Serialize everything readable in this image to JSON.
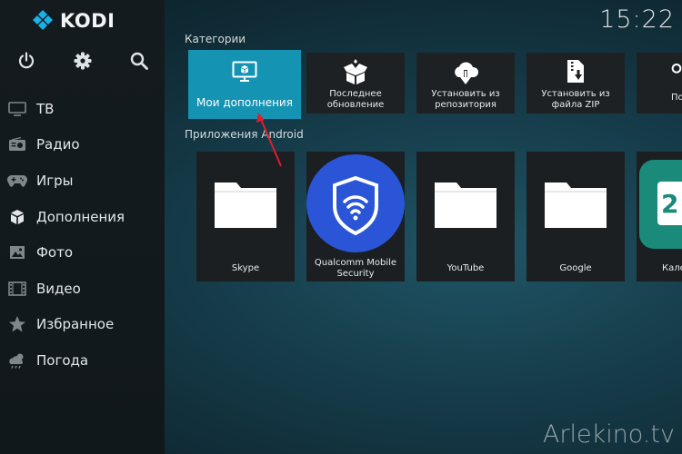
{
  "app": {
    "name": "KODI"
  },
  "clock": "15:22",
  "menu": [
    {
      "label": "ТВ",
      "icon": "tv-icon"
    },
    {
      "label": "Радио",
      "icon": "radio-icon"
    },
    {
      "label": "Игры",
      "icon": "gamepad-icon"
    },
    {
      "label": "Дополнения",
      "icon": "addons-box-icon"
    },
    {
      "label": "Фото",
      "icon": "photo-icon"
    },
    {
      "label": "Видео",
      "icon": "film-icon"
    },
    {
      "label": "Избранное",
      "icon": "star-icon"
    },
    {
      "label": "Погода",
      "icon": "weather-icon"
    }
  ],
  "categories": {
    "title": "Категории",
    "tiles": [
      {
        "label": "Мои дополнения",
        "icon": "monitor-box-icon",
        "focused": true
      },
      {
        "label": "Последнее обновление",
        "icon": "open-box-icon"
      },
      {
        "label": "Установить из репозитория",
        "icon": "cloud-download-icon"
      },
      {
        "label": "Установить из файла ZIP",
        "icon": "zip-file-icon"
      },
      {
        "label": "По",
        "icon": "search-icon"
      }
    ]
  },
  "apps": {
    "title": "Приложения Android",
    "tiles": [
      {
        "label": "Skype",
        "icon": "folder-icon"
      },
      {
        "label": "Qualcomm Mobile Security",
        "icon": "shield-wifi-icon"
      },
      {
        "label": "YouTube",
        "icon": "folder-icon"
      },
      {
        "label": "Google",
        "icon": "folder-icon"
      },
      {
        "label": "Кале",
        "icon": "calendar-icon",
        "icon_text": "2"
      }
    ]
  },
  "watermark": "Arlekino.tv",
  "colors": {
    "focus": "#1593b3",
    "arrow": "#e01e2a",
    "qualcomm": "#2a55d6",
    "calendar": "#1a8a7a"
  }
}
